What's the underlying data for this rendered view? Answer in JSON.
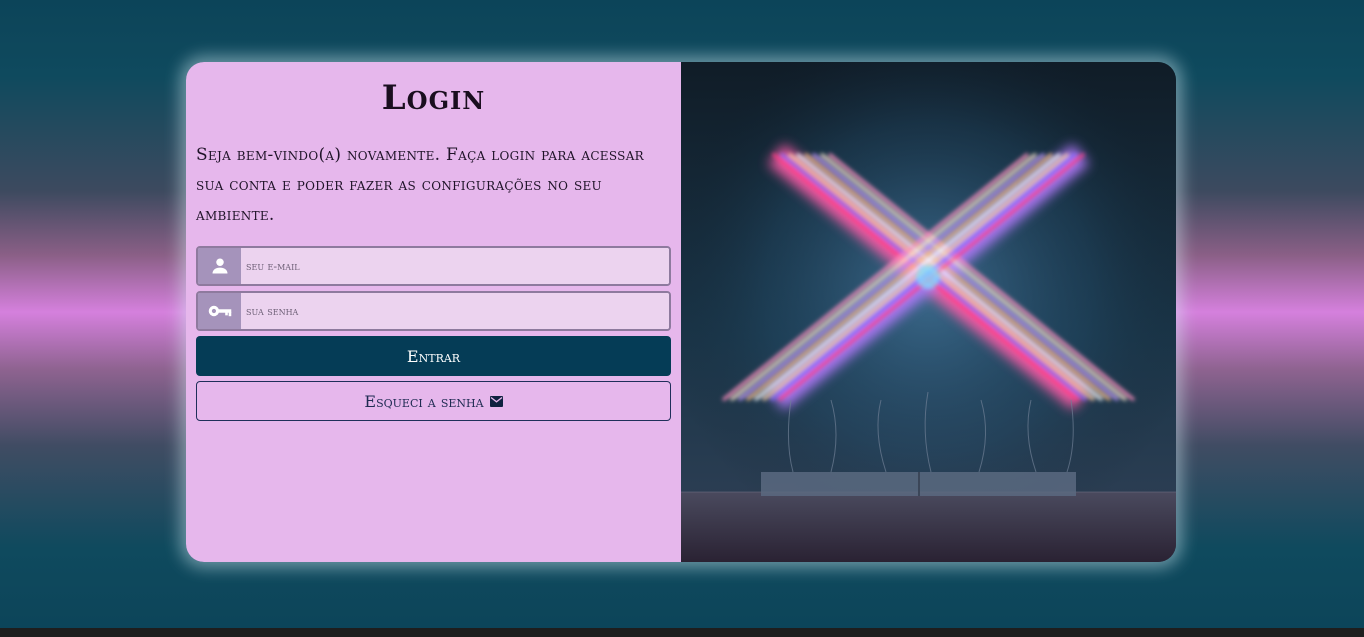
{
  "login": {
    "title": "Login",
    "intro": "Seja bem-vindo(a) novamente. Faça login para acessar sua conta e poder fazer as configurações no seu ambiente.",
    "email": {
      "placeholder": "seu e-mail",
      "value": "",
      "icon": "user-icon"
    },
    "password": {
      "placeholder": "sua senha",
      "value": "",
      "icon": "key-icon"
    },
    "submit_label": "Entrar",
    "forgot_label": "Esqueci a senha",
    "forgot_icon": "envelope-icon"
  },
  "theme": {
    "card_left_bg": "#e6b7ec",
    "primary_button": "#053c56",
    "icon_box": "#a593bb",
    "input_bg": "#ecd3ef"
  },
  "image": {
    "subject": "neon-x-sign"
  }
}
